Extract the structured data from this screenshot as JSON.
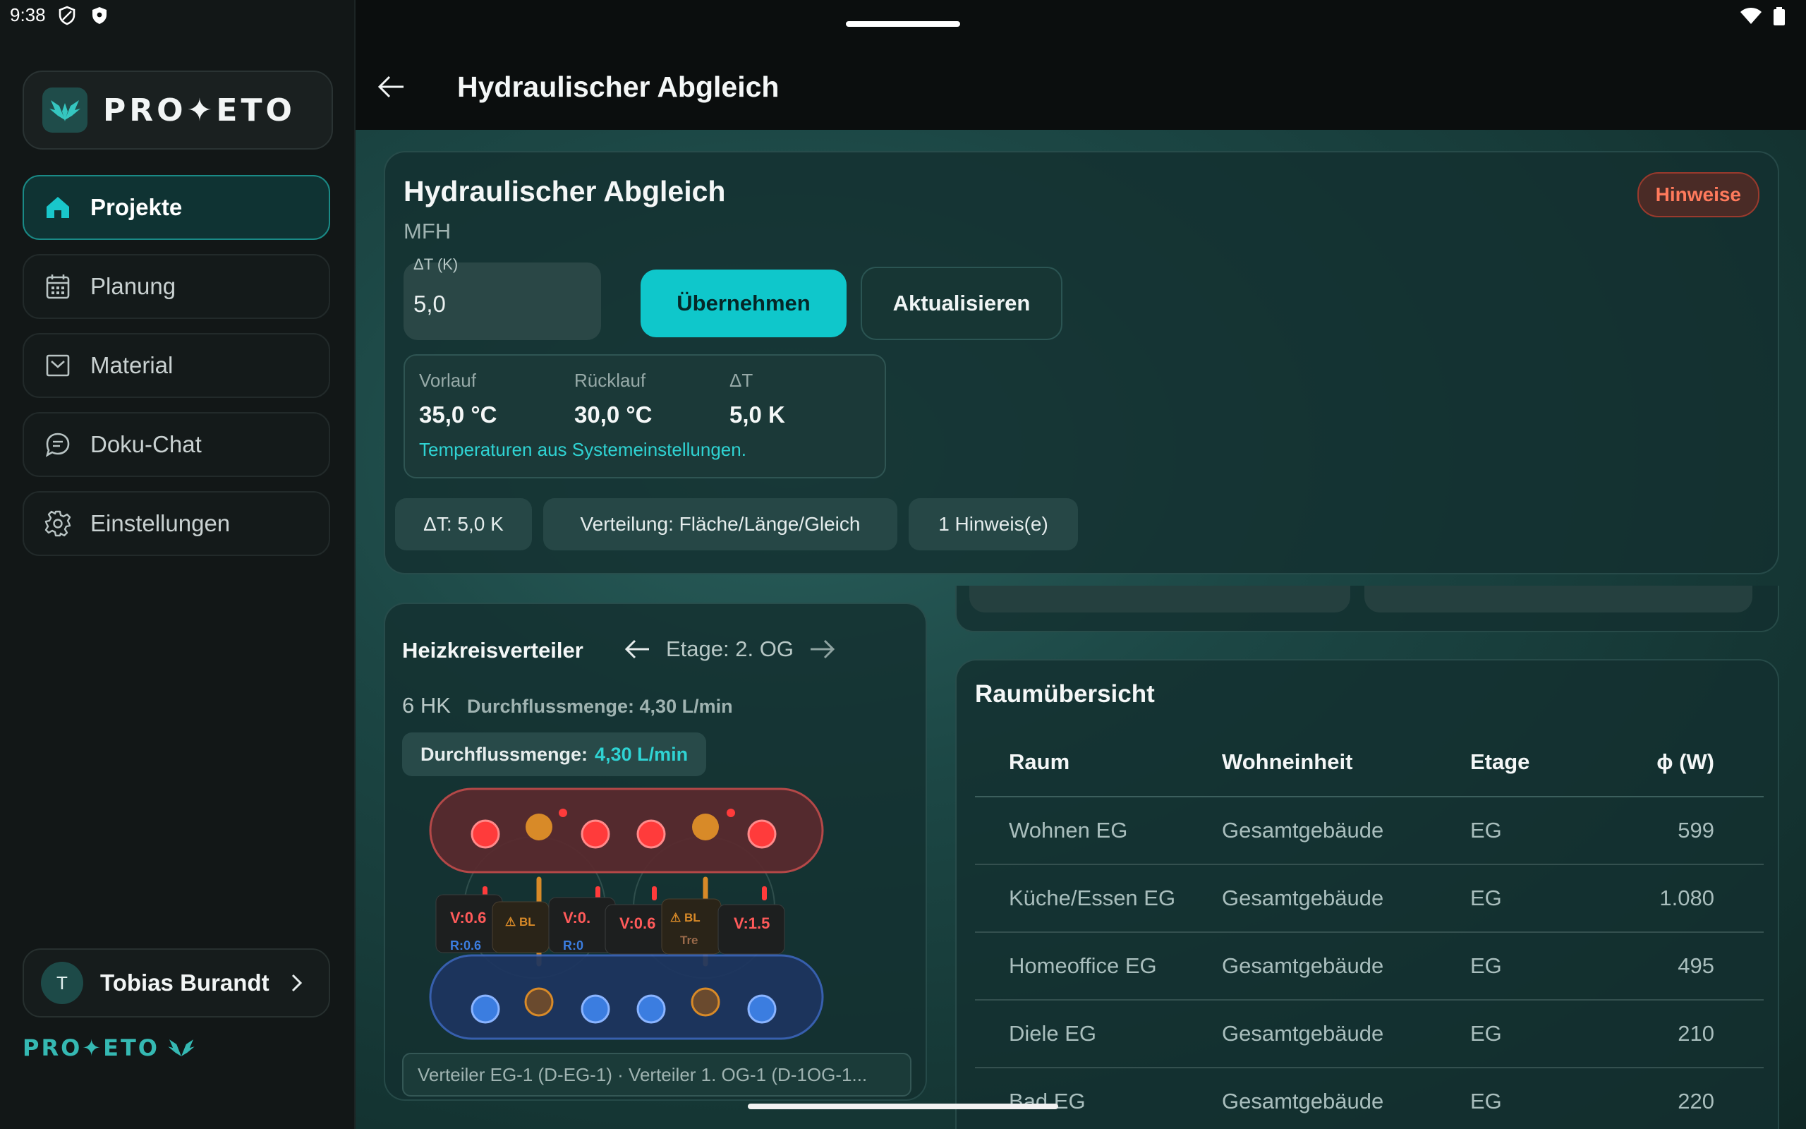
{
  "status_bar": {
    "time": "9:38"
  },
  "sidebar": {
    "logo_text": "PRO✦ETO",
    "items": [
      {
        "label": "Projekte",
        "icon": "home-icon",
        "active": true
      },
      {
        "label": "Planung",
        "icon": "calendar-icon",
        "active": false
      },
      {
        "label": "Material",
        "icon": "inbox-icon",
        "active": false
      },
      {
        "label": "Doku-Chat",
        "icon": "chat-icon",
        "active": false
      },
      {
        "label": "Einstellungen",
        "icon": "gear-icon",
        "active": false
      }
    ],
    "user": {
      "initial": "T",
      "name": "Tobias Burandt"
    },
    "footer_logo": "PRO✦ETO"
  },
  "header": {
    "title": "Hydraulischer Abgleich"
  },
  "summary": {
    "title": "Hydraulischer Abgleich",
    "subtitle": "MFH",
    "hint_button": "Hinweise",
    "dt_field": {
      "label": "ΔT (K)",
      "value": "5,0"
    },
    "apply_button": "Übernehmen",
    "refresh_button": "Aktualisieren",
    "temps": {
      "vorlauf_label": "Vorlauf",
      "vorlauf_value": "35,0 °C",
      "ruecklauf_label": "Rücklauf",
      "ruecklauf_value": "30,0 °C",
      "dt_label": "ΔT",
      "dt_value": "5,0 K",
      "note": "Temperaturen aus Systemeinstellungen."
    },
    "chips": [
      "ΔT: 5,0 K",
      "Verteilung: Fläche/Länge/Gleich",
      "1 Hinweis(e)"
    ]
  },
  "distributor": {
    "title": "Heizkreisverteiler",
    "etage": "Etage: 2. OG",
    "count": "6 HK",
    "flow_text": "Durchflussmenge: 4,30 L/min",
    "badge_label": "Durchflussmenge:",
    "badge_value": "4,30 L/min",
    "tags": [
      "V:0.6",
      "V:0.",
      "V:0.6",
      "V:1.5"
    ],
    "small_tags": [
      "BL",
      "BL",
      "Tre",
      "R:0.6",
      "R:0"
    ],
    "footer": "Verteiler EG-1 (D-EG-1) · Verteiler 1. OG-1 (D-1OG-1..."
  },
  "rooms": {
    "title": "Raumübersicht",
    "columns": [
      "Raum",
      "Wohneinheit",
      "Etage",
      "ϕ (W)"
    ],
    "rows": [
      [
        "Wohnen EG",
        "Gesamtgebäude",
        "EG",
        "599"
      ],
      [
        "Küche/Essen EG",
        "Gesamtgebäude",
        "EG",
        "1.080"
      ],
      [
        "Homeoffice EG",
        "Gesamtgebäude",
        "EG",
        "495"
      ],
      [
        "Diele EG",
        "Gesamtgebäude",
        "EG",
        "210"
      ],
      [
        "Bad EG",
        "Gesamtgebäude",
        "EG",
        "220"
      ]
    ]
  },
  "colors": {
    "accent": "#0fc7cb",
    "warning": "#ff7a5c",
    "supply": "#e84848",
    "return": "#3b7de0"
  }
}
